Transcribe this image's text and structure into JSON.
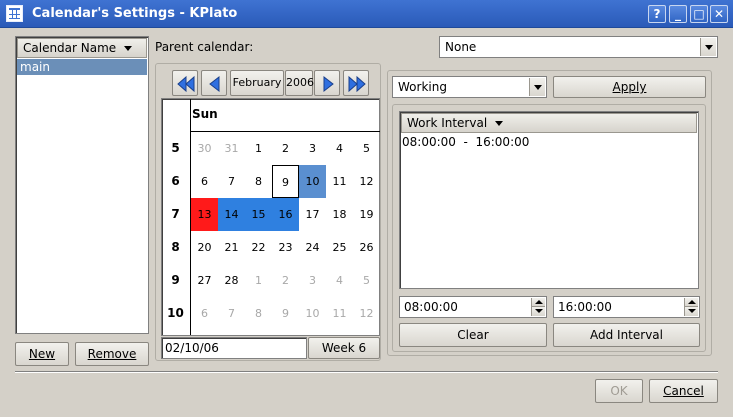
{
  "window": {
    "title": "Calendar's Settings - KPlato",
    "controls": [
      "?",
      "_",
      "□",
      "✕"
    ]
  },
  "calendar_list": {
    "header": "Calendar Name",
    "items": [
      "main"
    ],
    "new_label": "New",
    "remove_label": "Remove"
  },
  "parent": {
    "label": "Parent calendar:",
    "value": "None"
  },
  "date_nav": {
    "month": "February",
    "year": "2006"
  },
  "calendar": {
    "day_header": "Sun",
    "weeks": [
      {
        "num": "5",
        "days": [
          [
            "30",
            "other"
          ],
          [
            "31",
            "other"
          ],
          [
            "1",
            ""
          ],
          [
            "2",
            ""
          ],
          [
            "3",
            ""
          ],
          [
            "4",
            ""
          ],
          [
            "5",
            ""
          ]
        ]
      },
      {
        "num": "6",
        "days": [
          [
            "6",
            ""
          ],
          [
            "7",
            ""
          ],
          [
            "8",
            ""
          ],
          [
            "9",
            "today"
          ],
          [
            "10",
            "sel-steel"
          ],
          [
            "11",
            ""
          ],
          [
            "12",
            ""
          ]
        ]
      },
      {
        "num": "7",
        "days": [
          [
            "13",
            "sel-red"
          ],
          [
            "14",
            "sel-blue"
          ],
          [
            "15",
            "sel-blue"
          ],
          [
            "16",
            "sel-blue"
          ],
          [
            "17",
            ""
          ],
          [
            "18",
            ""
          ],
          [
            "19",
            ""
          ]
        ]
      },
      {
        "num": "8",
        "days": [
          [
            "20",
            ""
          ],
          [
            "21",
            ""
          ],
          [
            "22",
            ""
          ],
          [
            "23",
            ""
          ],
          [
            "24",
            ""
          ],
          [
            "25",
            ""
          ],
          [
            "26",
            ""
          ]
        ]
      },
      {
        "num": "9",
        "days": [
          [
            "27",
            ""
          ],
          [
            "28",
            ""
          ],
          [
            "1",
            "other"
          ],
          [
            "2",
            "other"
          ],
          [
            "3",
            "other"
          ],
          [
            "4",
            "other"
          ],
          [
            "5",
            "other"
          ]
        ]
      },
      {
        "num": "10",
        "days": [
          [
            "6",
            "other"
          ],
          [
            "7",
            "other"
          ],
          [
            "8",
            "other"
          ],
          [
            "9",
            "other"
          ],
          [
            "10",
            "other"
          ],
          [
            "11",
            "other"
          ],
          [
            "12",
            "other"
          ]
        ]
      }
    ],
    "date_field": "02/10/06",
    "week_label": "Week 6"
  },
  "state": {
    "value": "Working",
    "apply_label": "Apply"
  },
  "intervals": {
    "header": "Work Interval",
    "items": [
      "08:00:00  -  16:00:00"
    ],
    "start": "08:00:00",
    "end": "16:00:00",
    "clear_label": "Clear",
    "add_label": "Add Interval"
  },
  "footer": {
    "ok_label": "OK",
    "cancel_label": "Cancel"
  },
  "colors": {
    "title_bar": "#3f73d2",
    "selection_blue": "#2f80e0",
    "selection_red": "#ff1a1a",
    "list_selection": "#6b8fb8"
  }
}
